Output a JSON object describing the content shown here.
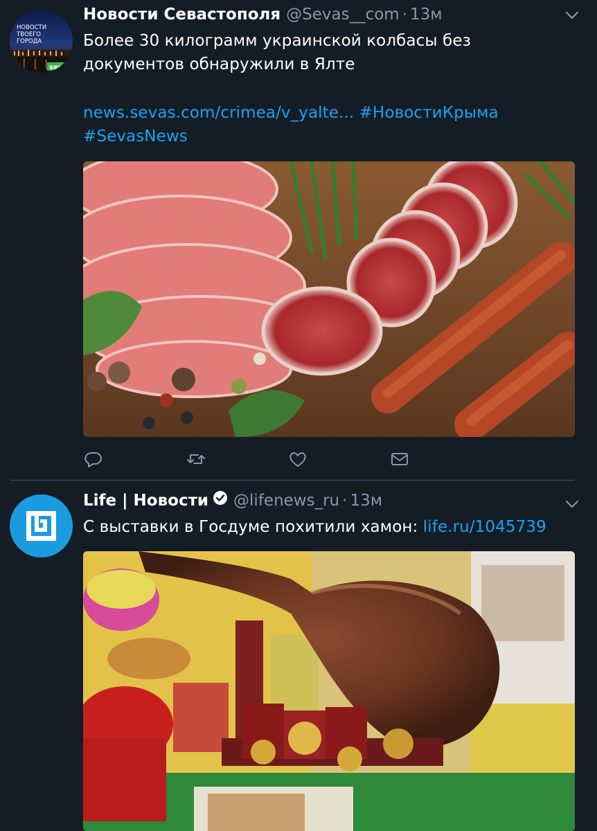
{
  "tweets": [
    {
      "name": "Новости Севастополя",
      "handle": "@Sevas__com",
      "separator": "·",
      "time": "13м",
      "text_line1": "Более 30 килограмм украинской колбасы без",
      "text_line2": "документов обнаружили в Ялте",
      "link_url": "news.sevas.com/crimea/v_yalte...",
      "hashtag1": "#НовостиКрыма",
      "hashtag2": "#SevasNews",
      "avatar_text": [
        "НОВОСТИ",
        "ТВОЕГО",
        "ГОРОДА"
      ],
      "avatar_brand": "sevas",
      "verified": false
    },
    {
      "name": "Life | Новости",
      "handle": "@lifenews_ru",
      "separator": "·",
      "time": "13м",
      "text": "С выставки в Госдуме похитили хамон: ",
      "link_url": "life.ru/1045739",
      "verified": true
    }
  ],
  "icons": [
    "reply-icon",
    "retweet-icon",
    "like-icon",
    "message-icon",
    "chevron-down-icon",
    "verified-badge-icon"
  ],
  "colors": {
    "background": "#141d26",
    "link": "#1da1f2",
    "secondary": "#8899a6",
    "divider": "#3d5466"
  }
}
